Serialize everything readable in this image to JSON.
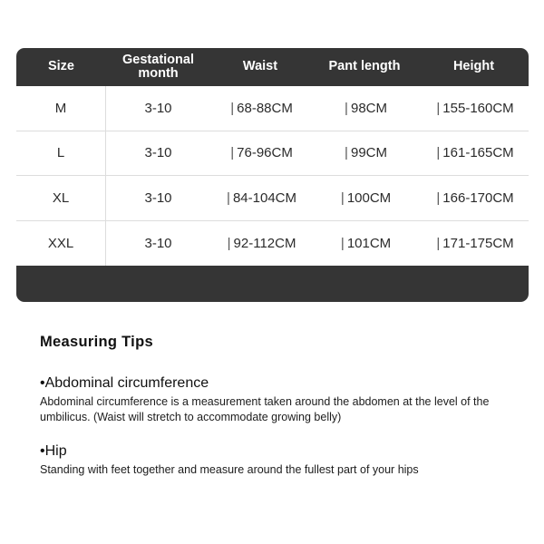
{
  "size_chart": {
    "columns": [
      "Size",
      "Gestational month",
      "Waist",
      "Pant length",
      "Height"
    ],
    "column_labels": {
      "size": "Size",
      "gestational_line1": "Gestational",
      "gestational_line2": "month",
      "waist": "Waist",
      "pant_length": "Pant length",
      "height": "Height"
    },
    "separator": "|",
    "rows": [
      {
        "size": "M",
        "gestational_month": "3-10",
        "waist": "68-88CM",
        "pant_length": "98CM",
        "height": "155-160CM"
      },
      {
        "size": "L",
        "gestational_month": "3-10",
        "waist": "76-96CM",
        "pant_length": "99CM",
        "height": "161-165CM"
      },
      {
        "size": "XL",
        "gestational_month": "3-10",
        "waist": "84-104CM",
        "pant_length": "100CM",
        "height": "166-170CM"
      },
      {
        "size": "XXL",
        "gestational_month": "3-10",
        "waist": "92-112CM",
        "pant_length": "101CM",
        "height": "171-175CM"
      }
    ],
    "colors": {
      "header_background": "#353535",
      "header_text": "#ffffff",
      "body_background": "#ffffff",
      "body_text": "#2b2b2b",
      "grid_line": "#dddddd"
    }
  },
  "measuring_tips": {
    "heading": "Measuring Tips",
    "tips": [
      {
        "title": "•Abdominal circumference",
        "body": "Abdominal circumference is a measurement taken around the abdomen at the level of the umbilicus. (Waist will stretch to accommodate growing belly)"
      },
      {
        "title": "•Hip",
        "body": "Standing with feet together and measure around the fullest part of your hips"
      }
    ]
  }
}
